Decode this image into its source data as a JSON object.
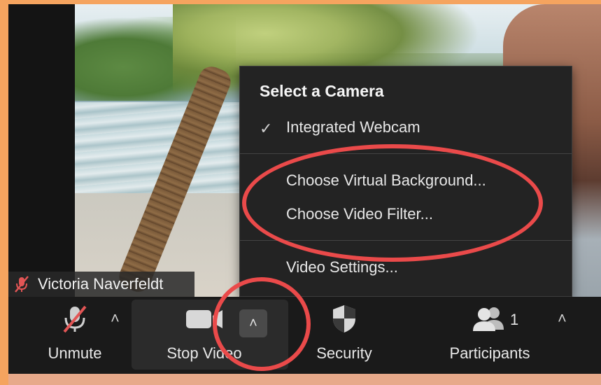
{
  "participant": {
    "name": "Victoria Naverfeldt",
    "mic_status_icon": "muted-mic-icon"
  },
  "camera_menu": {
    "title": "Select a Camera",
    "items": [
      {
        "label": "Integrated Webcam",
        "checked": true
      },
      {
        "label": "Choose Virtual Background..."
      },
      {
        "label": "Choose Video Filter..."
      },
      {
        "label": "Video Settings..."
      }
    ]
  },
  "toolbar": {
    "unmute_label": "Unmute",
    "stop_video_label": "Stop Video",
    "security_label": "Security",
    "participants_label": "Participants",
    "participants_count": "1"
  },
  "colors": {
    "highlight": "#ea4a4a",
    "frame": "#f5a45f",
    "menu_bg": "#232323",
    "toolbar_bg": "#1a1a1a"
  }
}
